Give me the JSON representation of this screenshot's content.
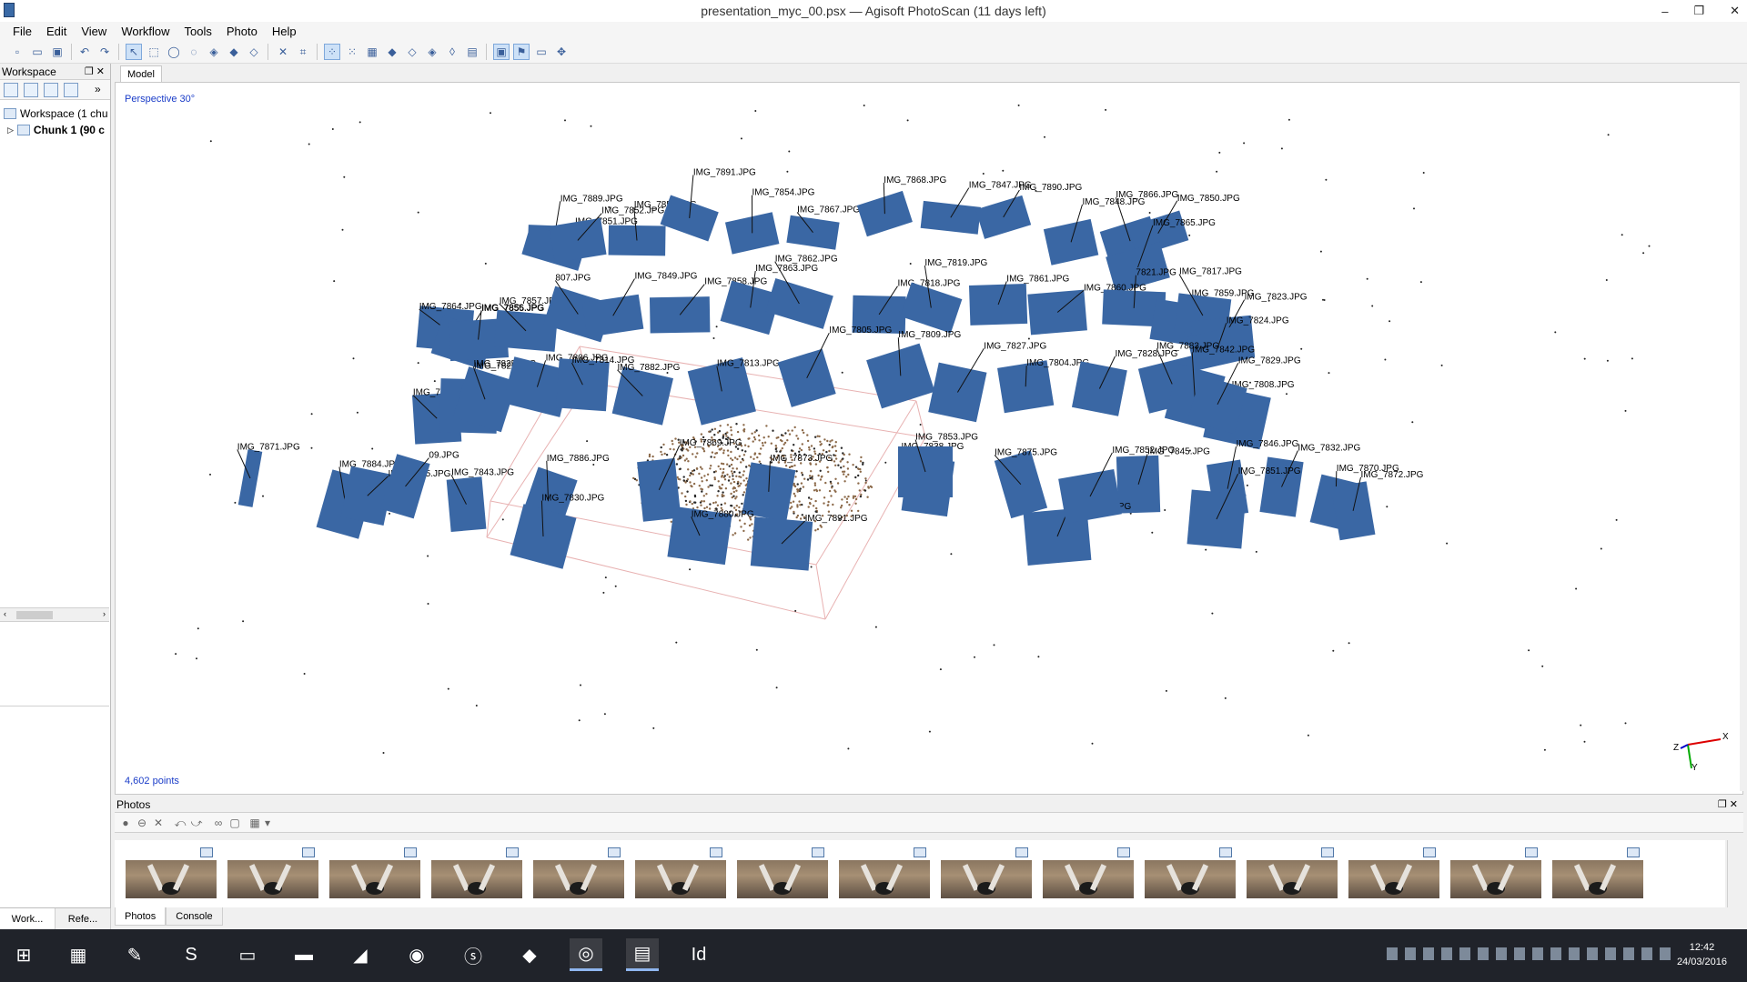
{
  "window": {
    "title": "presentation_myc_00.psx — Agisoft PhotoScan (11 days left)",
    "controls": [
      "–",
      "❐",
      "✕"
    ]
  },
  "menu": [
    "File",
    "Edit",
    "View",
    "Workflow",
    "Tools",
    "Photo",
    "Help"
  ],
  "workspace": {
    "header": "Workspace",
    "tree": [
      "Workspace (1 chu",
      "Chunk 1 (90 c"
    ],
    "bottom_tabs": [
      "Work...",
      "Refe..."
    ]
  },
  "model": {
    "tab": "Model",
    "projection": "Perspective 30°",
    "points_count": "4,602 points",
    "axis_labels": {
      "x": "X",
      "y": "Y",
      "z": "Z"
    },
    "camera_labels": [
      "IMG_7889.JPG",
      "IMG_7851.JPG",
      "IMG_7852.JPG",
      "IMG_7853.JPG",
      "IMG_7891.JPG",
      "IMG_7854.JPG",
      "IMG_7867.JPG",
      "IMG_7868.JPG",
      "IMG_7847.JPG",
      "IMG_7890.JPG",
      "IMG_7848.JPG",
      "IMG_7866.JPG",
      "IMG_7850.JPG",
      "IMG_7865.JPG",
      "IMG_7864.JPG",
      "IMG_7855.JPG",
      "IMG_7856.JPG",
      "IMG_7857.JPG",
      "807.JPG",
      "IMG_7849.JPG",
      "IMG_7858.JPG",
      "IMG_7863.JPG",
      "IMG_7862.JPG",
      "IMG_7818.JPG",
      "IMG_7819.JPG",
      "IMG_7861.JPG",
      "IMG_7860.JPG",
      "7821.JPG",
      "IMG_7859.JPG",
      "IMG_7817.JPG",
      "IMG_7823.JPG",
      "IMG_7824.JPG",
      "IMG_7815.JPG",
      "IMG_7825.JPG",
      "IMG_7826.JPG",
      "IMG_7806.JPG",
      "IMG_7814.JPG",
      "IMG_7882.JPG",
      "IMG_7813.JPG",
      "IMG_7805.JPG",
      "IMG_7809.JPG",
      "IMG_7827.JPG",
      "IMG_7804.JPG",
      "IMG_7828.JPG",
      "IMG_7883.JPG",
      "IMG_7842.JPG",
      "IMG_7808.JPG",
      "IMG_7829.JPG",
      "IMG_7884.JPG",
      "IMG_7885.JPG",
      "09.JPG",
      "IMG_7843.JPG",
      "IMG_7886.JPG",
      "IMG_7869.JPG",
      "IMG_7873.JPG",
      "IMG_7838.JPG",
      "IMG_7875.JPG",
      "IMG_7845.JPG",
      "IMG_7846.JPG",
      "IMG_7832.JPG",
      "IMG_7870.JPG",
      "IMG_7872.JPG",
      "IMG_7871.JPG",
      "IMG_7830.JPG",
      "IMG_7880.JPG"
    ]
  },
  "photos": {
    "header": "Photos",
    "thumbnail_count": 15,
    "bottom_tabs": [
      "Photos",
      "Console"
    ]
  },
  "taskbar": {
    "time": "12:42",
    "date": "24/03/2016"
  },
  "colors": {
    "camera_plane": "#3a67a4",
    "cloud_point": "#8c6a4a",
    "overlay_text": "#1a3cc8"
  }
}
